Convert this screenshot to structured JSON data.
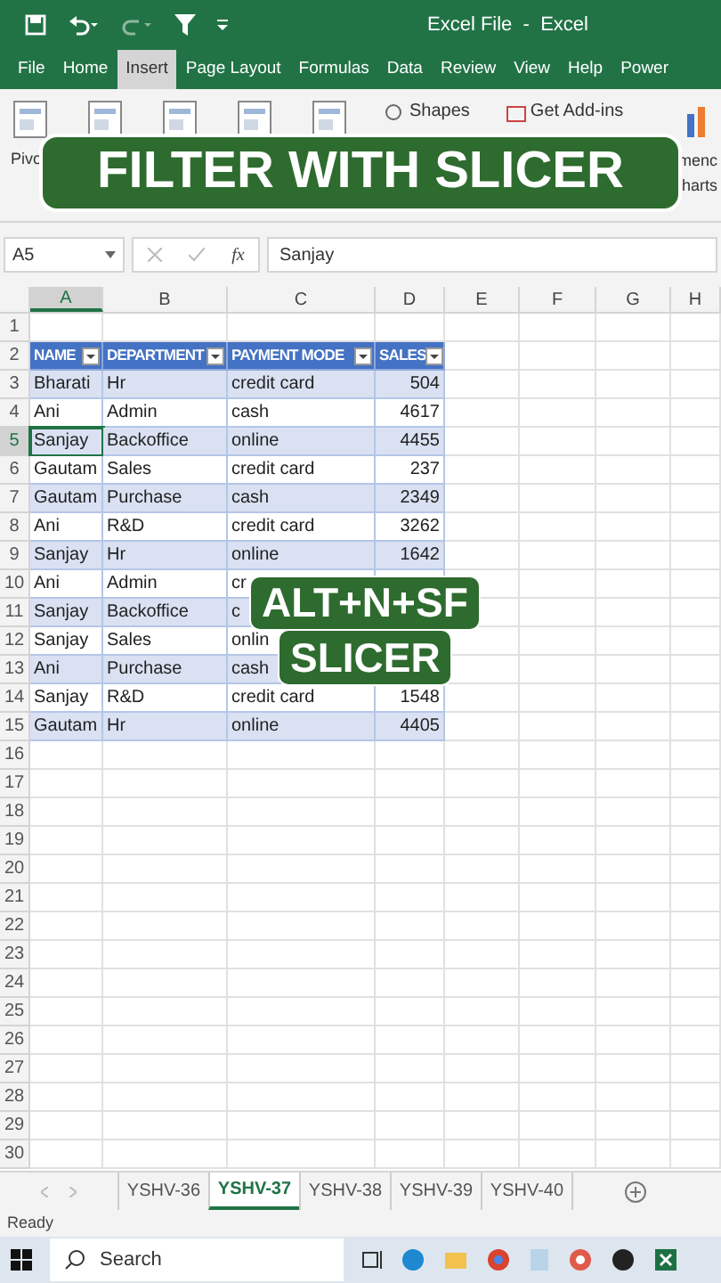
{
  "title_bar": {
    "title": "Excel File  -  Excel"
  },
  "menu_tabs": [
    {
      "label": "File",
      "selected": false
    },
    {
      "label": "Home",
      "selected": false
    },
    {
      "label": "Insert",
      "selected": true
    },
    {
      "label": "Page Layout",
      "selected": false
    },
    {
      "label": "Formulas",
      "selected": false
    },
    {
      "label": "Data",
      "selected": false
    },
    {
      "label": "Review",
      "selected": false
    },
    {
      "label": "View",
      "selected": false
    },
    {
      "label": "Help",
      "selected": false
    },
    {
      "label": "Power",
      "selected": false
    }
  ],
  "ribbon": {
    "pivot": "Pivo",
    "shapes": "Shapes",
    "add_ins": "Get Add-ins",
    "charts_1": "menc",
    "charts_2": "harts"
  },
  "banner": "FILTER WITH SLICER",
  "formula_bar": {
    "name_box": "A5",
    "fx": "fx",
    "value": "Sanjay"
  },
  "columns": [
    {
      "label": "A",
      "selected": true
    },
    {
      "label": "B",
      "selected": false
    },
    {
      "label": "C",
      "selected": false
    },
    {
      "label": "D",
      "selected": false
    },
    {
      "label": "E",
      "selected": false
    },
    {
      "label": "F",
      "selected": false
    },
    {
      "label": "G",
      "selected": false
    },
    {
      "label": "H",
      "selected": false
    }
  ],
  "row_numbers": [
    {
      "label": "1",
      "selected": false
    },
    {
      "label": "2",
      "selected": false
    },
    {
      "label": "3",
      "selected": false
    },
    {
      "label": "4",
      "selected": false
    },
    {
      "label": "5",
      "selected": true
    },
    {
      "label": "6",
      "selected": false
    },
    {
      "label": "7",
      "selected": false
    },
    {
      "label": "8",
      "selected": false
    },
    {
      "label": "9",
      "selected": false
    },
    {
      "label": "10",
      "selected": false
    },
    {
      "label": "11",
      "selected": false
    },
    {
      "label": "12",
      "selected": false
    },
    {
      "label": "13",
      "selected": false
    },
    {
      "label": "14",
      "selected": false
    },
    {
      "label": "15",
      "selected": false
    },
    {
      "label": "16",
      "selected": false
    },
    {
      "label": "17",
      "selected": false
    },
    {
      "label": "18",
      "selected": false
    },
    {
      "label": "19",
      "selected": false
    },
    {
      "label": "20",
      "selected": false
    },
    {
      "label": "21",
      "selected": false
    },
    {
      "label": "22",
      "selected": false
    },
    {
      "label": "23",
      "selected": false
    },
    {
      "label": "24",
      "selected": false
    },
    {
      "label": "25",
      "selected": false
    },
    {
      "label": "26",
      "selected": false
    },
    {
      "label": "27",
      "selected": false
    },
    {
      "label": "28",
      "selected": false
    },
    {
      "label": "29",
      "selected": false
    },
    {
      "label": "30",
      "selected": false
    }
  ],
  "table": {
    "header": [
      "NAME",
      "DEPARTMENT",
      "PAYMENT MODE",
      "SALES"
    ],
    "rows": [
      {
        "cells": [
          "Bharati",
          "Hr",
          "credit card",
          "504"
        ]
      },
      {
        "cells": [
          "Ani",
          "Admin",
          "cash",
          "4617"
        ]
      },
      {
        "cells": [
          "Sanjay",
          "Backoffice",
          "online",
          "4455"
        ],
        "selected": true
      },
      {
        "cells": [
          "Gautam",
          "Sales",
          "credit card",
          "237"
        ]
      },
      {
        "cells": [
          "Gautam",
          "Purchase",
          "cash",
          "2349"
        ]
      },
      {
        "cells": [
          "Ani",
          "R&D",
          "credit card",
          "3262"
        ]
      },
      {
        "cells": [
          "Sanjay",
          "Hr",
          "online",
          "1642"
        ]
      },
      {
        "cells": [
          "Ani",
          "Admin",
          "cr",
          null
        ]
      },
      {
        "cells": [
          "Sanjay",
          "Backoffice",
          "c",
          null
        ]
      },
      {
        "cells": [
          "Sanjay",
          "Sales",
          "onlin",
          null
        ]
      },
      {
        "cells": [
          "Ani",
          "Purchase",
          "cash",
          null
        ]
      },
      {
        "cells": [
          "Sanjay",
          "R&D",
          "credit card",
          "1548"
        ]
      },
      {
        "cells": [
          "Gautam",
          "Hr",
          "online",
          "4405"
        ]
      }
    ]
  },
  "overlay": [
    "ALT+N+SF",
    "SLICER"
  ],
  "sheet_tabs": [
    {
      "label": "YSHV-36",
      "selected": false
    },
    {
      "label": "YSHV-37",
      "selected": true
    },
    {
      "label": "YSHV-38",
      "selected": false
    },
    {
      "label": "YSHV-39",
      "selected": false
    },
    {
      "label": "YSHV-40",
      "selected": false
    }
  ],
  "status": "Ready",
  "taskbar": {
    "search_placeholder": "Search"
  }
}
